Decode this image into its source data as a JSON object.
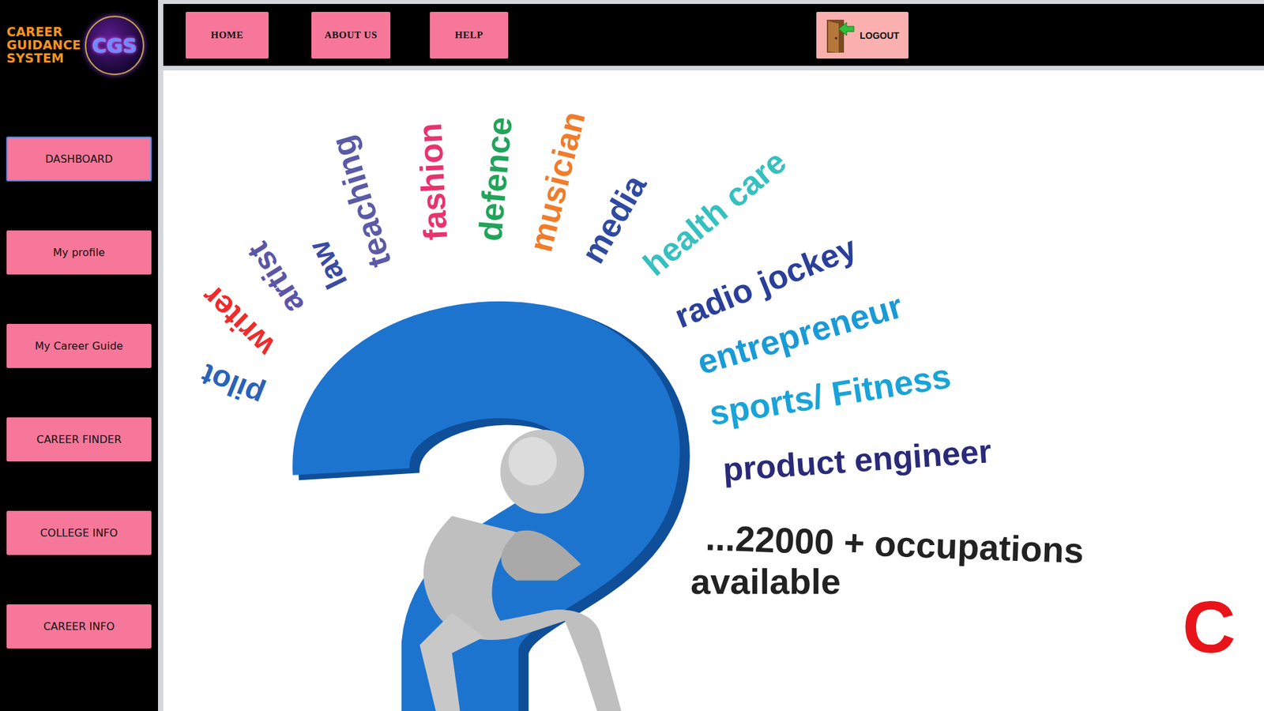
{
  "logo": {
    "lines": [
      "CAREER",
      "GUIDANCE",
      "SYSTEM"
    ],
    "badge": "CGS"
  },
  "topnav": {
    "items": [
      {
        "label": "HOME"
      },
      {
        "label": "ABOUT US"
      },
      {
        "label": "HELP"
      }
    ],
    "logout": {
      "label": "LOGOUT"
    }
  },
  "sidebar": {
    "items": [
      {
        "label": "DASHBOARD",
        "selected": true
      },
      {
        "label": "My profile",
        "selected": false
      },
      {
        "label": "My Career Guide",
        "selected": false
      },
      {
        "label": "CAREER FINDER",
        "selected": false
      },
      {
        "label": "COLLEGE INFO",
        "selected": false
      },
      {
        "label": "CAREER INFO",
        "selected": false
      }
    ]
  },
  "hero": {
    "words": [
      {
        "text": "pilot",
        "color": "#2a62b8"
      },
      {
        "text": "writer",
        "color": "#ef2b2b"
      },
      {
        "text": "artist",
        "color": "#5b55a8"
      },
      {
        "text": "law",
        "color": "#3a4aa3"
      },
      {
        "text": "teaching",
        "color": "#5a5aa8"
      },
      {
        "text": "fashion",
        "color": "#e8336e"
      },
      {
        "text": "defence",
        "color": "#22a35a"
      },
      {
        "text": "musician",
        "color": "#f07c2a"
      },
      {
        "text": "media",
        "color": "#2f4aa0"
      },
      {
        "text": "health care",
        "color": "#35c0c0"
      },
      {
        "text": "radio jockey",
        "color": "#2a3f9a"
      },
      {
        "text": "entrepreneur",
        "color": "#1a9ad6"
      },
      {
        "text": "sports/ Fitness",
        "color": "#1aa3d8"
      },
      {
        "text": "product engineer",
        "color": "#2a2a7a"
      }
    ],
    "caption_lines": [
      "...22000 + occupations",
      "available"
    ]
  },
  "banner_text": "C"
}
